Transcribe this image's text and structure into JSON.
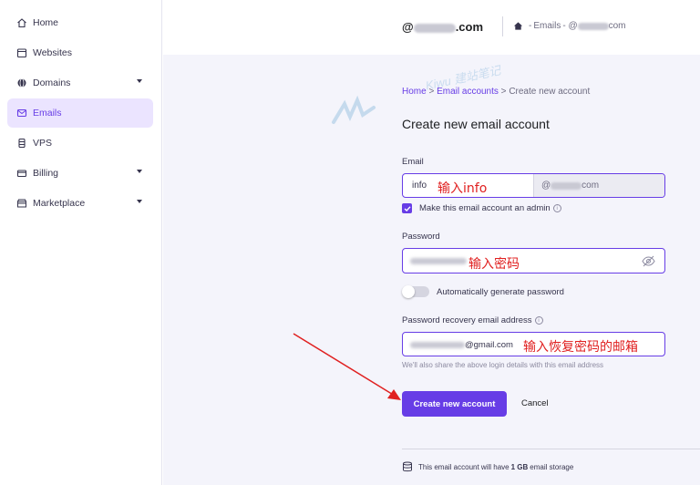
{
  "sidebar": {
    "items": [
      {
        "label": "Home",
        "icon": "home-icon"
      },
      {
        "label": "Websites",
        "icon": "browser-icon"
      },
      {
        "label": "Domains",
        "icon": "globe-icon"
      },
      {
        "label": "Emails",
        "icon": "mail-icon"
      },
      {
        "label": "VPS",
        "icon": "server-icon"
      },
      {
        "label": "Billing",
        "icon": "card-icon"
      },
      {
        "label": "Marketplace",
        "icon": "store-icon"
      }
    ],
    "active": "Emails",
    "accent": "#673de6"
  },
  "header": {
    "domain_prefix": "@",
    "domain_suffix": ".com",
    "crumb_sep1": " - ",
    "crumb_emails": "Emails",
    "crumb_sep2": " - @",
    "crumb_suffix": "com"
  },
  "breadcrumb": {
    "home": "Home",
    "sep": " > ",
    "email_accounts": "Email accounts",
    "current": "Create new account"
  },
  "form": {
    "title": "Create new email account",
    "email_label": "Email",
    "email_value": "info",
    "email_domain_prefix": "@",
    "email_domain_suffix": "com",
    "admin_checkbox_label": "Make this email account an admin",
    "admin_checked": true,
    "password_label": "Password",
    "auto_generate_label": "Automatically generate password",
    "auto_generate_on": false,
    "recovery_label": "Password recovery email address",
    "recovery_value_suffix": "@gmail.com",
    "helper_text": "We'll also share the above login details with this email address",
    "create_button": "Create new account",
    "cancel_button": "Cancel"
  },
  "annotations": {
    "email": "输入info",
    "password": "输入密码",
    "recovery": "输入恢复密码的邮箱",
    "color": "#e02020"
  },
  "footer": {
    "storage_pre": "This email account will have ",
    "storage_amount": "1 GB",
    "storage_post": " email storage"
  },
  "watermark": {
    "text": "Kiwu 建站笔记"
  }
}
